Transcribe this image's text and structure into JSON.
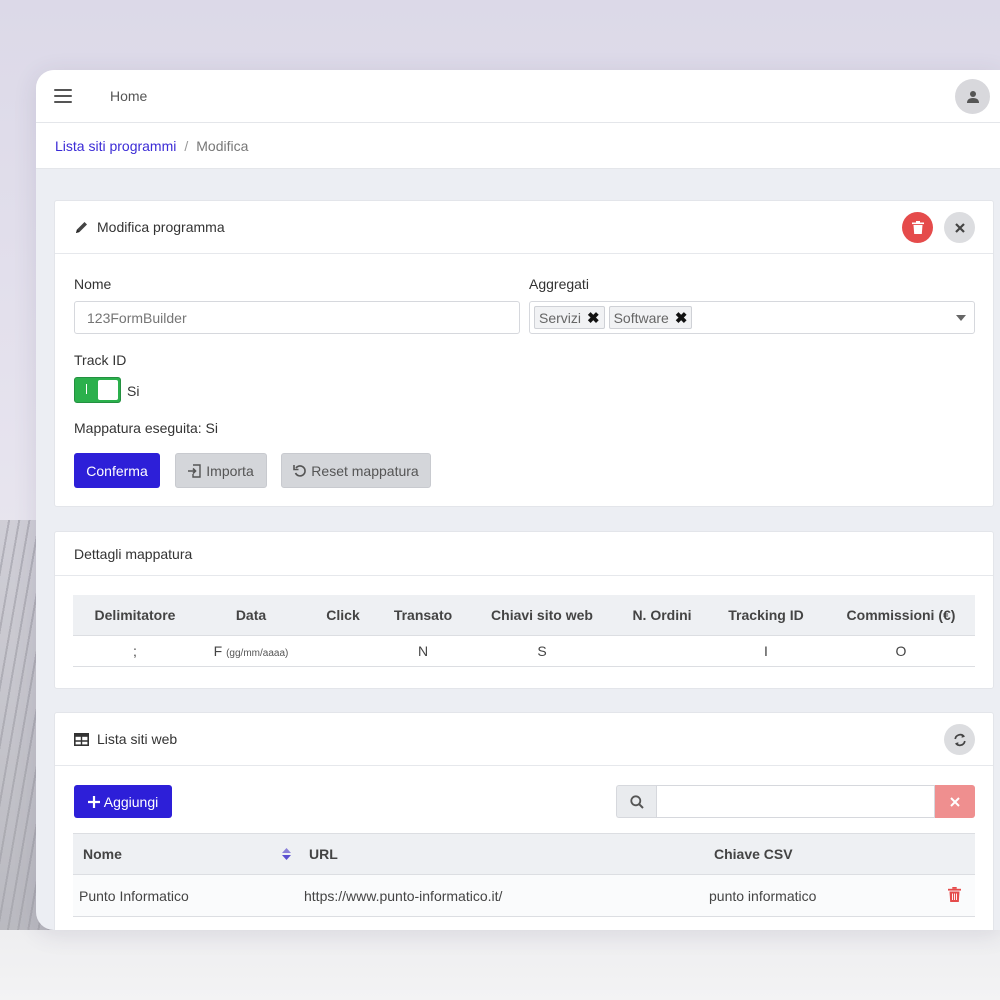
{
  "topbar": {
    "home_label": "Home"
  },
  "breadcrumb": {
    "parent": "Lista siti programmi",
    "separator": "/",
    "current": "Modifica"
  },
  "edit_card": {
    "title": "Modifica programma",
    "name_label": "Nome",
    "name_placeholder": "123FormBuilder",
    "aggregati_label": "Aggregati",
    "aggregati_tags": [
      "Servizi",
      "Software"
    ],
    "track_id_label": "Track ID",
    "track_id_value": "Si",
    "mapping_status": "Mappatura eseguita: Si",
    "confirm_label": "Conferma",
    "import_label": "Importa",
    "reset_label": "Reset mappatura"
  },
  "mapping_card": {
    "title": "Dettagli mappatura",
    "columns": [
      "Delimitatore",
      "Data",
      "Click",
      "Transato",
      "Chiavi sito web",
      "N. Ordini",
      "Tracking ID",
      "Commissioni (€)"
    ],
    "row": {
      "delimitatore": ";",
      "data": "F",
      "data_format": "(gg/mm/aaaa)",
      "click": "",
      "transato": "N",
      "chiavi": "S",
      "ordini": "",
      "tracking": "I",
      "commissioni": "O"
    }
  },
  "sites_card": {
    "title": "Lista siti web",
    "add_label": "Aggiungi",
    "search_value": "",
    "columns": [
      "Nome",
      "URL",
      "Chiave CSV"
    ],
    "rows": [
      {
        "nome": "Punto Informatico",
        "url": "https://www.punto-informatico.it/",
        "chiave": "punto informatico"
      }
    ]
  },
  "colors": {
    "primary": "#2d1fd8",
    "danger": "#e54b4b",
    "success": "#2bb04c",
    "link": "#3b2bd6"
  }
}
